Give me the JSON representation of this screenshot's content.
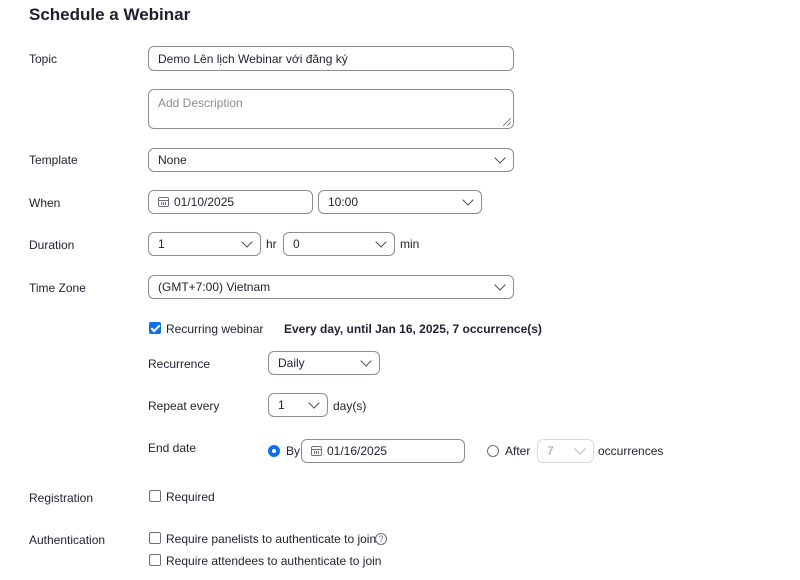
{
  "page": {
    "title": "Schedule a Webinar"
  },
  "topic": {
    "label": "Topic",
    "value": "Demo Lên lịch Webinar với đăng ký"
  },
  "description": {
    "placeholder": "Add Description"
  },
  "template": {
    "label": "Template",
    "value": "None"
  },
  "when": {
    "label": "When",
    "date": "01/10/2025",
    "time": "10:00"
  },
  "duration": {
    "label": "Duration",
    "hours": "1",
    "hr_unit": "hr",
    "minutes": "0",
    "min_unit": "min"
  },
  "timezone": {
    "label": "Time Zone",
    "value": "(GMT+7:00) Vietnam"
  },
  "recurring": {
    "checkbox_label": "Recurring webinar",
    "checked": true,
    "summary": "Every day, until Jan 16, 2025, 7 occurrence(s)",
    "recurrence_label": "Recurrence",
    "recurrence_value": "Daily",
    "repeat_label": "Repeat every",
    "repeat_value": "1",
    "repeat_unit": "day(s)",
    "end_label": "End date",
    "by_label": "By",
    "by_date": "01/16/2025",
    "after_label": "After",
    "after_value": "7",
    "occurrences_label": "occurrences"
  },
  "registration": {
    "label": "Registration",
    "checkbox_label": "Required"
  },
  "authentication": {
    "label": "Authentication",
    "panelists_label": "Require panelists to authenticate to join",
    "help_glyph": "?",
    "attendees_label": "Require attendees to authenticate to join"
  },
  "colors": {
    "accent": "#0e71eb",
    "border": "#8c8c97",
    "text": "#232333"
  }
}
